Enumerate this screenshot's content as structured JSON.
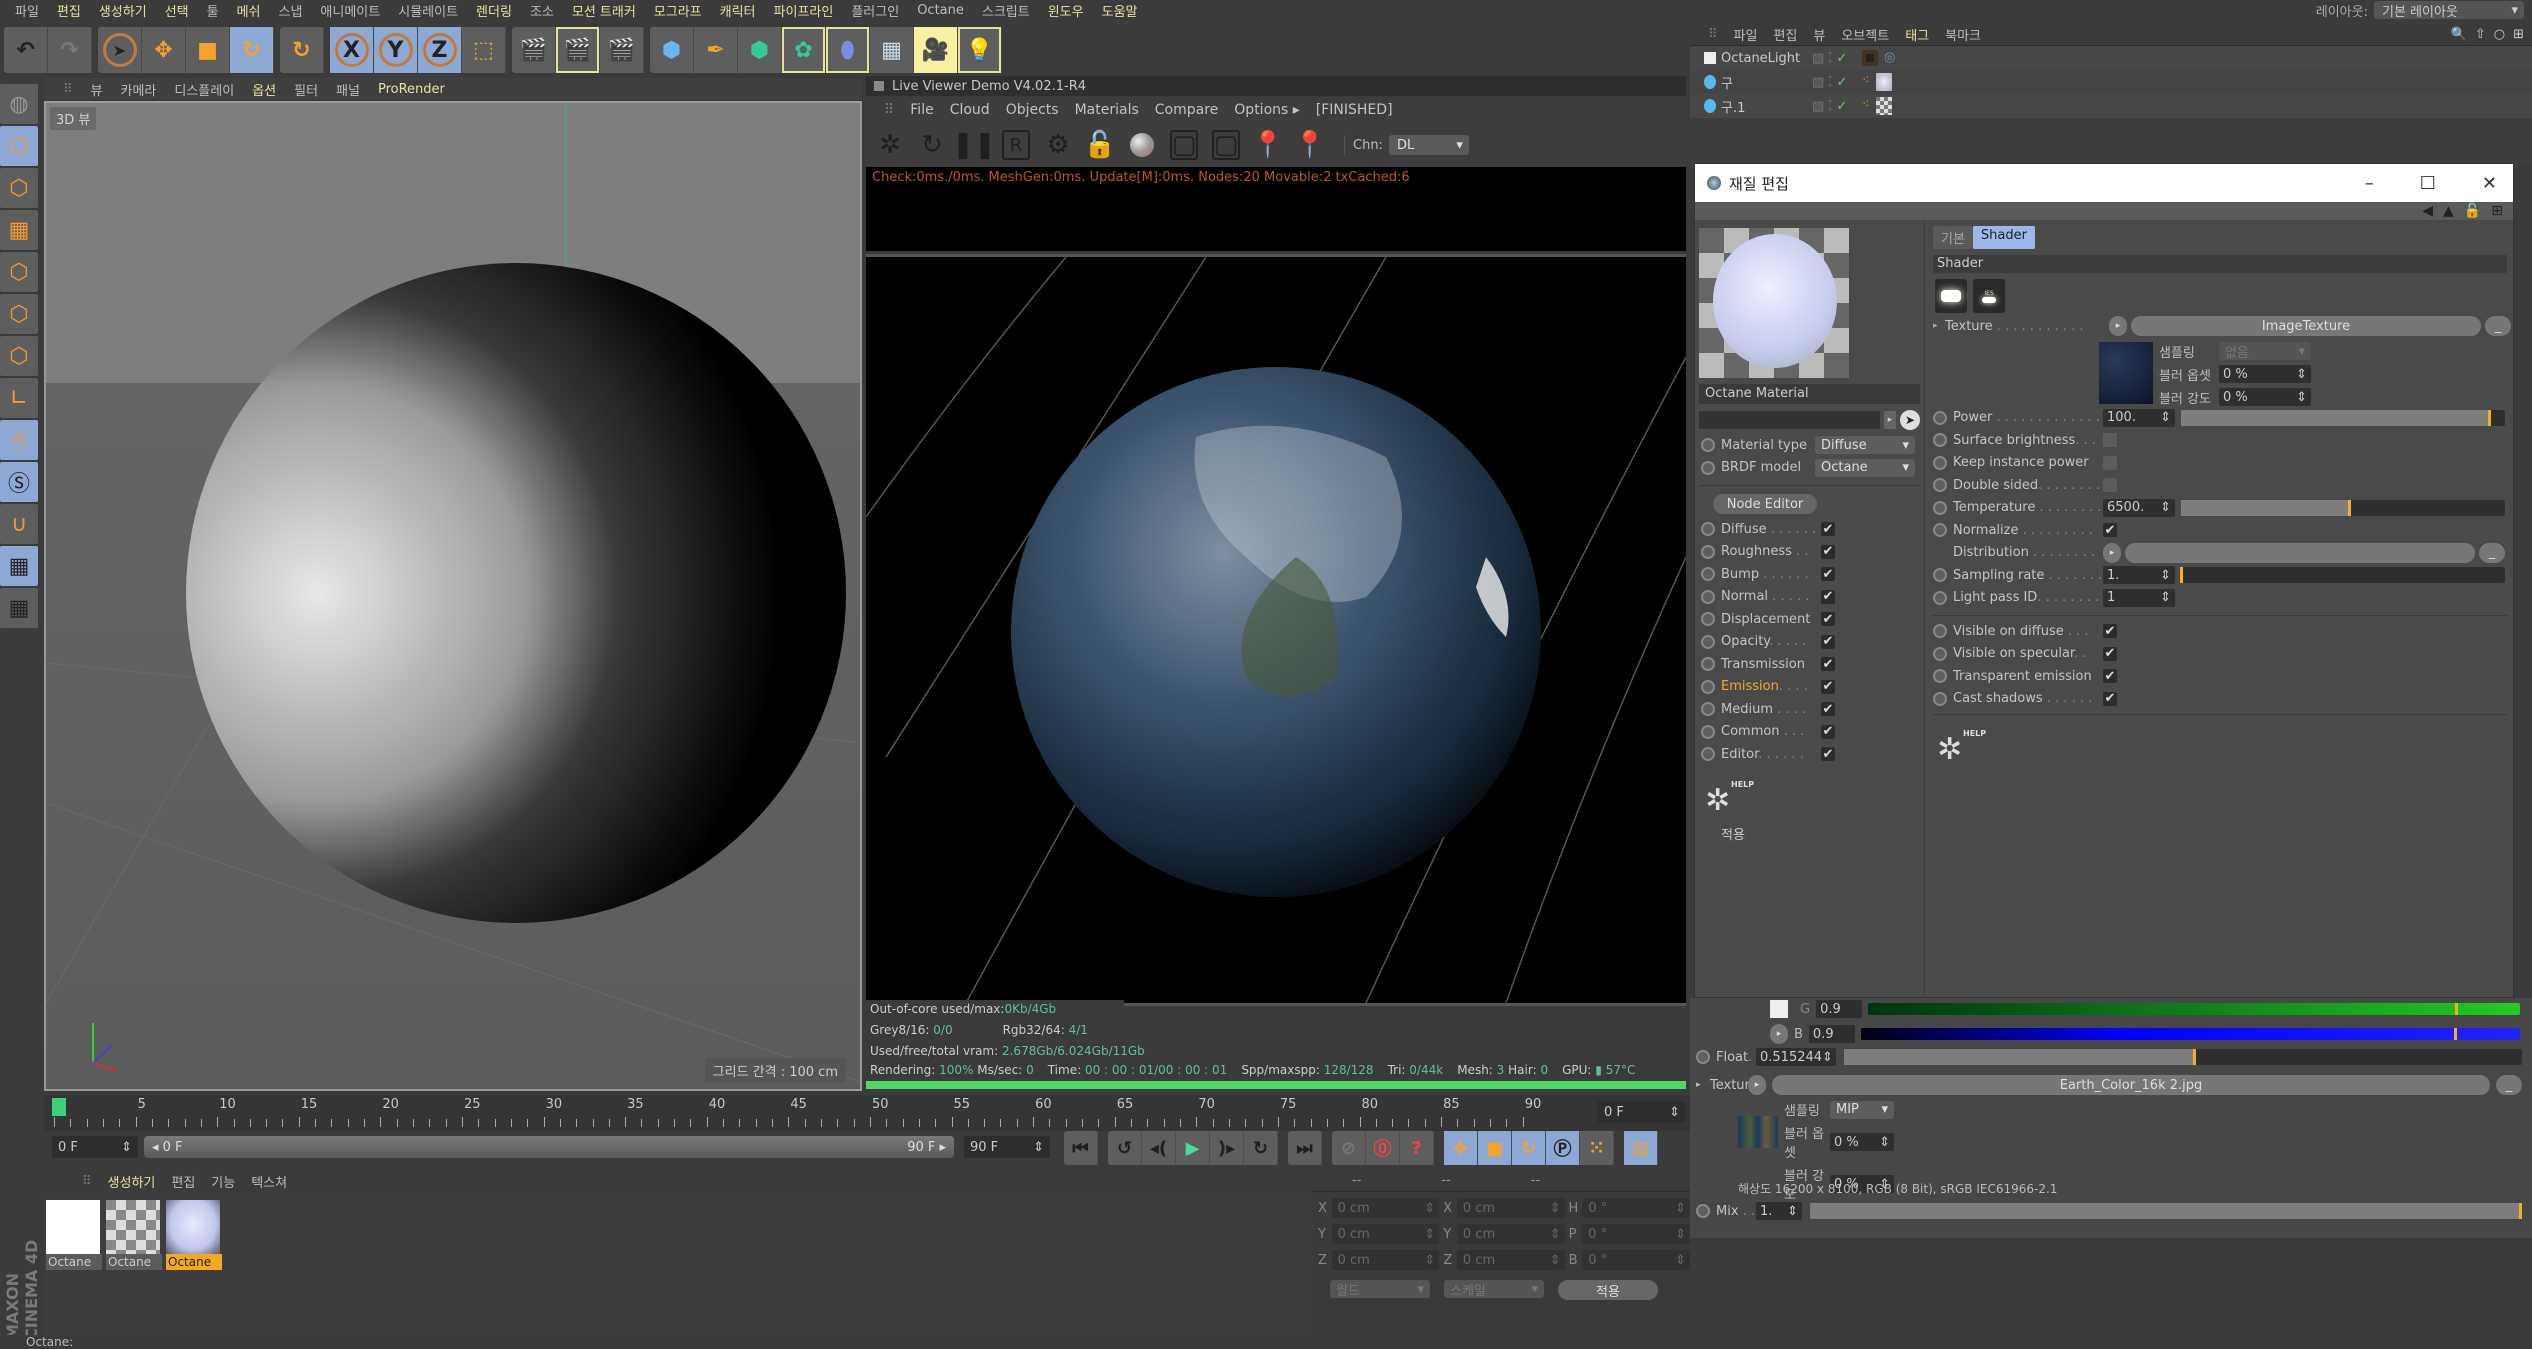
{
  "menubar": {
    "items": [
      {
        "label": "파일",
        "hl": false
      },
      {
        "label": "편집",
        "hl": true
      },
      {
        "label": "생성하기",
        "hl": true
      },
      {
        "label": "선택",
        "hl": true
      },
      {
        "label": "툴",
        "hl": false
      },
      {
        "label": "메쉬",
        "hl": true
      },
      {
        "label": "스냅",
        "hl": false
      },
      {
        "label": "애니메이트",
        "hl": false
      },
      {
        "label": "시뮬레이트",
        "hl": false
      },
      {
        "label": "렌더링",
        "hl": true
      },
      {
        "label": "조소",
        "hl": false
      },
      {
        "label": "모션 트래커",
        "hl": true
      },
      {
        "label": "모그라프",
        "hl": true
      },
      {
        "label": "캐릭터",
        "hl": true
      },
      {
        "label": "파이프라인",
        "hl": true
      },
      {
        "label": "플러그인",
        "hl": false
      },
      {
        "label": "Octane",
        "hl": false
      },
      {
        "label": "스크립트",
        "hl": false
      },
      {
        "label": "윈도우",
        "hl": true
      },
      {
        "label": "도움말",
        "hl": true
      }
    ],
    "layout_label": "레이아웃:",
    "layout_value": "기본 레이아웃"
  },
  "toolbar": {
    "icons": [
      "undo-icon",
      "redo-icon",
      "live-select-icon",
      "move-icon",
      "scale-icon",
      "rotate-icon",
      "recent-tool-icon",
      "x-axis-lock-icon",
      "y-axis-lock-icon",
      "z-axis-lock-icon",
      "coordinate-system-icon",
      "render-view-icon",
      "render-picture-viewer-icon",
      "render-settings-icon",
      "cube-icon",
      "pen-icon",
      "subdivision-icon",
      "cloner-icon",
      "deformer-icon",
      "floor-icon",
      "camera-icon",
      "light-icon"
    ],
    "axis_labels": [
      "X",
      "Y",
      "Z"
    ]
  },
  "viewport": {
    "menu": [
      {
        "label": "뷰",
        "hl": false
      },
      {
        "label": "카메라",
        "hl": false
      },
      {
        "label": "디스플레이",
        "hl": false
      },
      {
        "label": "옵션",
        "hl": true
      },
      {
        "label": "필터",
        "hl": false
      },
      {
        "label": "패널",
        "hl": false
      },
      {
        "label": "ProRender",
        "hl": true
      }
    ],
    "label": "3D 뷰",
    "grid_label": "그리드 간격 : 100 cm"
  },
  "live_viewer": {
    "title": "Live Viewer Demo V4.02.1-R4",
    "menu": [
      "File",
      "Cloud",
      "Objects",
      "Materials",
      "Compare",
      "Options ▸",
      "[FINISHED]"
    ],
    "channel_label": "Chn:",
    "channel_value": "DL",
    "status_line": "Check:0ms./0ms. MeshGen:0ms. Update[M]:0ms. Nodes:20 Movable:2 txCached:6",
    "info": {
      "out_of_core_label": "Out-of-core used/max:",
      "out_of_core_value": "0Kb/4Gb",
      "grey_label": "Grey8/16:",
      "grey_value": "0/0",
      "rgb_label": "Rgb32/64:",
      "rgb_value": "4/1",
      "vram_label": "Used/free/total vram:",
      "vram_value": "2.678Gb/6.024Gb/11Gb"
    },
    "render_stats": {
      "rendering_label": "Rendering:",
      "rendering_value": "100%",
      "mssec_label": "Ms/sec:",
      "mssec_value": "0",
      "time_label": "Time:",
      "time_value": "00 : 00 : 01/00 : 00 : 01",
      "spp_label": "Spp/maxspp:",
      "spp_value": "128/128",
      "tri_label": "Tri:",
      "tri_value": "0/44k",
      "mesh_label": "Mesh:",
      "mesh_value": "3",
      "hair_label": "Hair:",
      "hair_value": "0",
      "gpu_label": "GPU:",
      "gpu_temp": "57°C"
    },
    "progress": 1.0
  },
  "timeline": {
    "ticks": [
      "0",
      "5",
      "10",
      "15",
      "20",
      "25",
      "30",
      "35",
      "40",
      "45",
      "50",
      "55",
      "60",
      "65",
      "70",
      "75",
      "80",
      "85",
      "90"
    ],
    "current_frame": "0 F",
    "start_field": "0 F",
    "scrub_left": "◂ 0 F",
    "scrub_right": "90 F ▸",
    "end_field": "90 F"
  },
  "material_manager": {
    "menu": [
      {
        "label": "생성하기",
        "hl": true
      },
      {
        "label": "편집",
        "hl": false
      },
      {
        "label": "기능",
        "hl": false
      },
      {
        "label": "텍스쳐",
        "hl": false
      }
    ],
    "materials": [
      {
        "name": "Octane",
        "kind": "white",
        "active": false
      },
      {
        "name": "Octane",
        "kind": "checker",
        "active": false
      },
      {
        "name": "Octane",
        "kind": "earth",
        "active": true
      }
    ]
  },
  "coordinates": {
    "headers": [
      "--",
      "--",
      "--"
    ],
    "rows": [
      {
        "a": "X",
        "v1": "0 cm",
        "b": "X",
        "v2": "0 cm",
        "c": "H",
        "v3": "0 °"
      },
      {
        "a": "Y",
        "v1": "0 cm",
        "b": "Y",
        "v2": "0 cm",
        "c": "P",
        "v3": "0 °"
      },
      {
        "a": "Z",
        "v1": "0 cm",
        "b": "Z",
        "v2": "0 cm",
        "c": "B",
        "v3": "0 °"
      }
    ],
    "mode1": "월드",
    "mode2": "스케일",
    "apply": "적용"
  },
  "status_bar": "Octane:",
  "brand": "MAXON CINEMA 4D",
  "object_manager": {
    "menu": [
      {
        "label": "파일",
        "hl": false
      },
      {
        "label": "편집",
        "hl": false
      },
      {
        "label": "뷰",
        "hl": false
      },
      {
        "label": "오브젝트",
        "hl": false
      },
      {
        "label": "태그",
        "hl": true
      },
      {
        "label": "북마크",
        "hl": false
      }
    ],
    "objects": [
      {
        "name": "OctaneLight",
        "type": "light"
      },
      {
        "name": "구",
        "type": "sphere"
      },
      {
        "name": "구.1",
        "type": "sphere"
      }
    ]
  },
  "material_editor": {
    "title": "재질 편집",
    "material_name": "Octane Material",
    "material_type_label": "Material type",
    "material_type_value": "Diffuse",
    "brdf_label": "BRDF model",
    "brdf_value": "Octane",
    "node_editor": "Node Editor",
    "channels": [
      {
        "label": "Diffuse",
        "dots": " . . . . . .",
        "checked": true,
        "active": false
      },
      {
        "label": "Roughness",
        "dots": " . .",
        "checked": true,
        "active": false
      },
      {
        "label": "Bump",
        "dots": " . . . . . .",
        "checked": true,
        "active": false
      },
      {
        "label": "Normal",
        "dots": " . . . . .",
        "checked": true,
        "active": false
      },
      {
        "label": "Displacement",
        "dots": "",
        "checked": true,
        "active": false
      },
      {
        "label": "Opacity",
        "dots": ". . . . .",
        "checked": true,
        "active": false
      },
      {
        "label": "Transmission",
        "dots": "",
        "checked": true,
        "active": false
      },
      {
        "label": "Emission",
        "dots": ". . . .",
        "checked": true,
        "active": true
      },
      {
        "label": "Medium",
        "dots": " . . . .",
        "checked": true,
        "active": false
      },
      {
        "label": "Common",
        "dots": " . . .",
        "checked": true,
        "active": false
      },
      {
        "label": "Editor",
        "dots": ". . . . . .",
        "checked": true,
        "active": false
      }
    ],
    "apply_label": "적용",
    "help_label": "HELP",
    "tabs": [
      {
        "label": "기본",
        "active": false
      },
      {
        "label": "Shader",
        "active": true
      }
    ],
    "section": "Shader",
    "texture_label": "Texture",
    "texture_value": "ImageTexture",
    "sampling_label": "샘플링",
    "sampling_value": "없음",
    "blur_offset_label": "블러 옵셋",
    "blur_offset_value": "0 %",
    "blur_scale_label": "블러 강도",
    "blur_scale_value": "0 %",
    "power_label": "Power",
    "power_value": "100.",
    "power_fraction": 0.95,
    "surface_brightness_label": "Surface brightness",
    "surface_brightness": false,
    "keep_instance_label": "Keep instance power",
    "keep_instance": false,
    "double_sided_label": "Double sided",
    "double_sided": false,
    "temperature_label": "Temperature",
    "temperature_value": "6500.",
    "temperature_fraction": 0.52,
    "normalize_label": "Normalize",
    "normalize": true,
    "distribution_label": "Distribution",
    "sampling_rate_label": "Sampling rate",
    "sampling_rate_value": "1.",
    "sampling_rate_fraction": 0.0,
    "light_pass_label": "Light pass ID",
    "light_pass_value": "1",
    "visible_diffuse_label": "Visible on diffuse",
    "visible_specular_label": "Visible on specular",
    "transparent_emission_label": "Transparent emission",
    "cast_shadows_label": "Cast shadows",
    "visible_diffuse": true,
    "visible_specular": true,
    "transparent_emission": true,
    "cast_shadows": true
  },
  "lower_attributes": {
    "g_label": "G",
    "g_value": "0.9",
    "g_fraction": 0.9,
    "b_label": "B",
    "b_value": "0.9",
    "b_fraction": 0.9,
    "float_label": "Float",
    "float_value": "0.515244",
    "float_fraction": 0.515,
    "texture_label": "Texture",
    "texture_file": "Earth_Color_16k 2.jpg",
    "sampling_label": "샘플링",
    "sampling_value": "MIP",
    "blur_offset_label": "블러 옵셋",
    "blur_offset_value": "0 %",
    "blur_scale_label": "블러 강도",
    "blur_scale_value": "0 %",
    "resolution": "해상도 16200 x 8100, RGB (8 Bit), sRGB IEC61966-2.1",
    "mix_label": "Mix",
    "mix_value": "1.",
    "mix_fraction": 1.0
  }
}
